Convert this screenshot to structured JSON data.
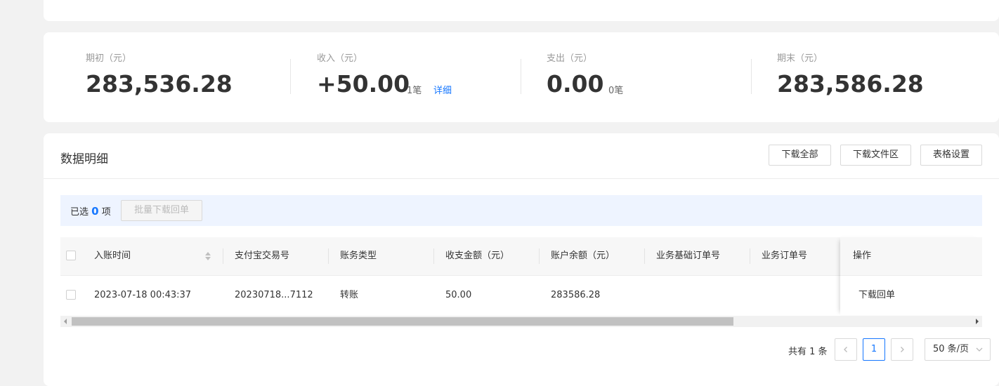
{
  "notice": {
    "text": ""
  },
  "summary": {
    "opening": {
      "label": "期初（元）",
      "value": "283,536.28"
    },
    "income": {
      "label": "收入（元）",
      "value": "+50.00",
      "count": "1笔",
      "detail_link": "详细"
    },
    "expense": {
      "label": "支出（元）",
      "value": "0.00",
      "count": "0笔"
    },
    "closing": {
      "label": "期末（元）",
      "value": "283,586.28"
    }
  },
  "detail": {
    "title": "数据明细",
    "buttons": {
      "download_all": "下载全部",
      "download_area": "下载文件区",
      "table_settings": "表格设置"
    },
    "selection": {
      "prefix": "已选",
      "count": "0",
      "suffix": "项",
      "batch_button": "批量下载回单"
    },
    "table": {
      "columns": [
        "入账时间",
        "支付宝交易号",
        "账务类型",
        "收支金额（元）",
        "账户余额（元）",
        "业务基础订单号",
        "业务订单号",
        "操作"
      ],
      "rows": [
        {
          "time": "2023-07-18 00:43:37",
          "trade_no": "20230718...7112",
          "type": "转账",
          "amount": "50.00",
          "balance": "283586.28",
          "base_order": "",
          "order": "",
          "action": "下载回单"
        }
      ]
    },
    "pagination": {
      "total": "共有 1 条",
      "current_page": "1",
      "page_size": "50 条/页"
    }
  },
  "colors": {
    "accent": "#1677ff",
    "background": "#f2f2f2",
    "selection_bar": "#eef4ff"
  },
  "icons": [
    "sort-icon",
    "chevron-left-icon",
    "chevron-right-icon",
    "chevron-down-icon",
    "scroll-left-arrow-icon",
    "scroll-right-arrow-icon"
  ]
}
